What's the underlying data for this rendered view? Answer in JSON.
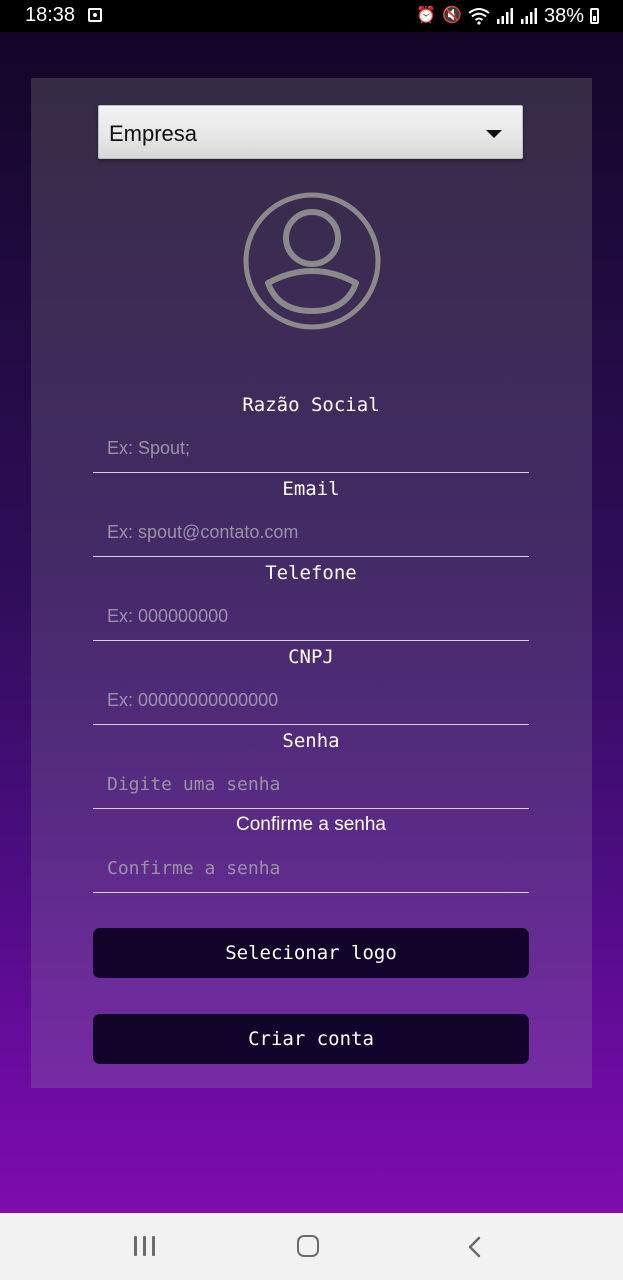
{
  "status_bar": {
    "time": "18:38",
    "battery": "38%",
    "icons": [
      "notification-app-icon",
      "alarm-icon",
      "mute-icon",
      "wifi-icon",
      "signal-icon",
      "signal-icon",
      "battery-icon"
    ]
  },
  "form": {
    "account_type": {
      "selected": "Empresa"
    },
    "avatar_icon": "user-avatar-icon",
    "fields": {
      "razao_social": {
        "label": "Razão Social",
        "placeholder": "Ex: Spout;"
      },
      "email": {
        "label": "Email",
        "placeholder": "Ex: spout@contato.com"
      },
      "telefone": {
        "label": "Telefone",
        "placeholder": "Ex: 000000000"
      },
      "cnpj": {
        "label": "CNPJ",
        "placeholder": "Ex: 00000000000000"
      },
      "senha": {
        "label": "Senha",
        "placeholder": "Digite uma senha"
      },
      "confirme": {
        "label": "Confirme a senha",
        "placeholder": "Confirme a senha"
      }
    },
    "select_logo_button": "Selecionar logo",
    "create_account_button": "Criar conta"
  },
  "nav_bar": {
    "icons": [
      "recent-apps-icon",
      "home-icon",
      "back-icon"
    ]
  },
  "colors": {
    "background_top": "#120628",
    "background_bottom": "#7e0cae",
    "button_bg": "#12032a",
    "input_line": "#d6d0dc",
    "placeholder": "#9a92a8"
  }
}
